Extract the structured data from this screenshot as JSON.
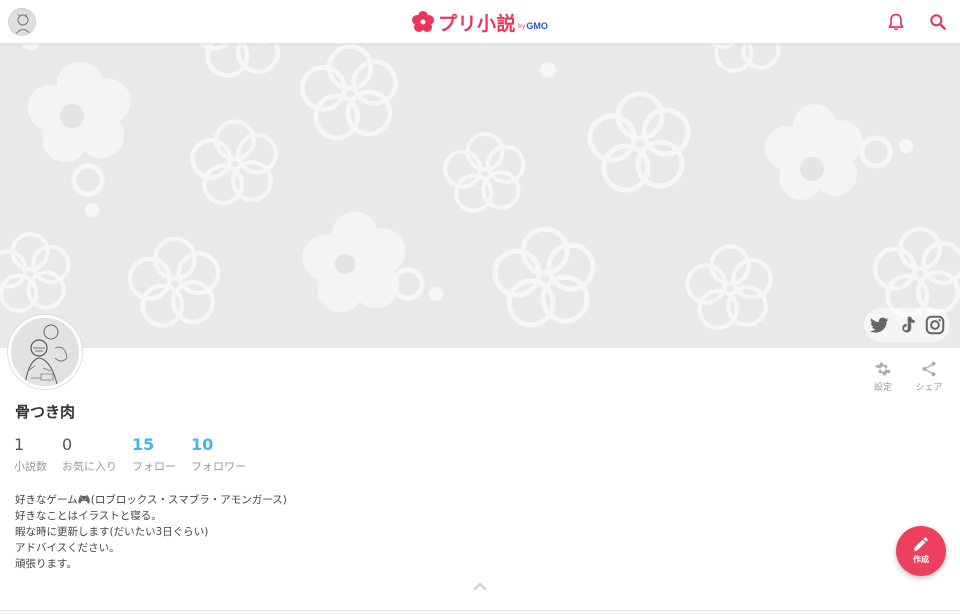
{
  "header": {
    "logo_text": "プリ小説",
    "logo_by": "by",
    "logo_gmo": "GMO",
    "icons": [
      "avatar",
      "bell-icon",
      "search-icon"
    ]
  },
  "cover": {
    "social_icons": [
      "twitter-icon",
      "tiktok-icon",
      "instagram-icon"
    ]
  },
  "profile": {
    "username": "骨つき肉",
    "actions": {
      "settings_label": "設定",
      "share_label": "シェア"
    },
    "stats": [
      {
        "value": "1",
        "label": "小説数"
      },
      {
        "value": "0",
        "label": "お気に入り"
      },
      {
        "value": "15",
        "label": "フォロー"
      },
      {
        "value": "10",
        "label": "フォロワー"
      }
    ],
    "bio": [
      "好きなゲーム🎮(ロブロックス・スマブラ・アモンガース)",
      "好きなことはイラストと寝る。",
      "暇な時に更新します(だいたい3日ぐらい)",
      "アドバイスください。",
      "頑張ります。"
    ]
  },
  "fab": {
    "label": "作成"
  },
  "colors": {
    "brand": "#e8375a",
    "link": "#4ab3e8",
    "fab": "#ef3f5e",
    "cover": "#e9e9e9"
  }
}
